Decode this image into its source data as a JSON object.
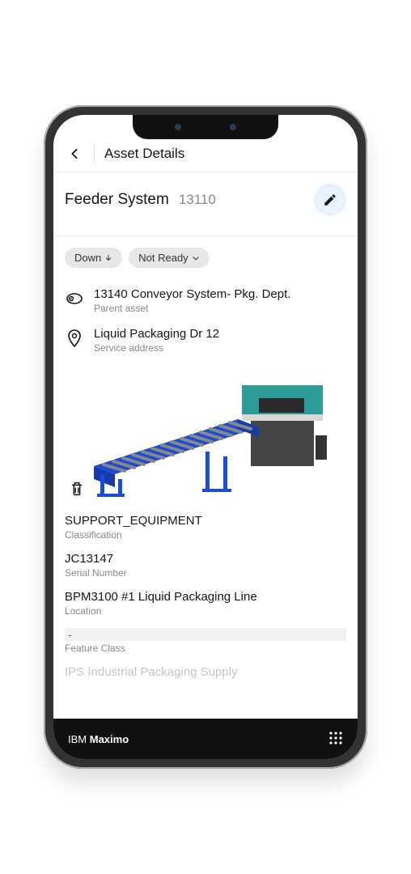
{
  "header": {
    "title": "Asset Details"
  },
  "asset": {
    "name": "Feeder System",
    "id": "13110"
  },
  "status": {
    "down": "Down",
    "not_ready": "Not Ready"
  },
  "parent": {
    "value": "13140 Conveyor System- Pkg. Dept.",
    "label": "Parent asset"
  },
  "service_address": {
    "value": "Liquid Packaging Dr 12",
    "label": "Service address"
  },
  "fields": {
    "classification": {
      "value": "SUPPORT_EQUIPMENT",
      "label": "Classification"
    },
    "serial": {
      "value": "JC13147",
      "label": "Serial Number"
    },
    "location": {
      "value": "BPM3100 #1 Liquid Packaging Line",
      "label": "Location"
    },
    "feature_class": {
      "value": "-",
      "label": "Feature Class"
    },
    "next_cutoff": "IPS Industrial Packaging Supply"
  },
  "footer": {
    "brand_prefix": "IBM ",
    "brand_bold": "Maximo"
  }
}
